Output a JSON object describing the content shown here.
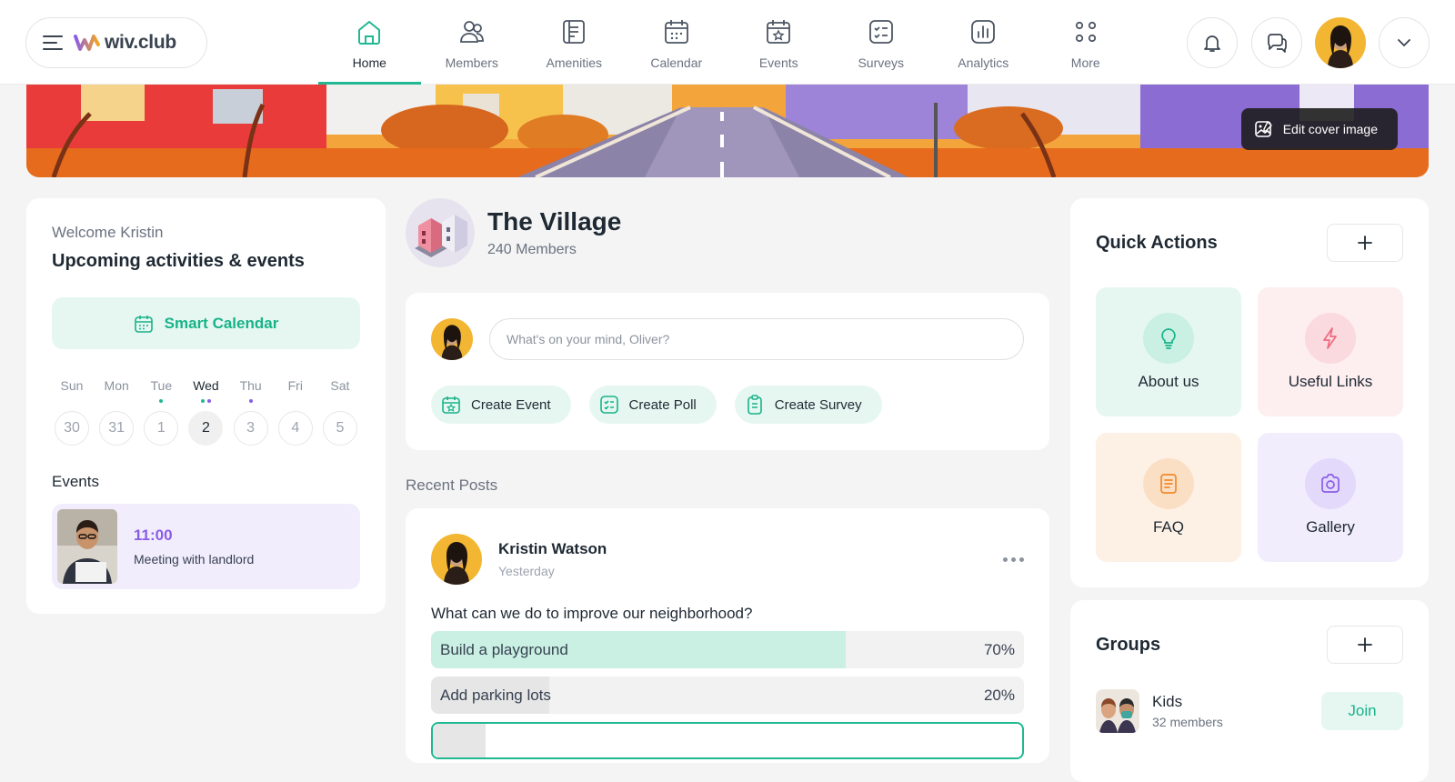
{
  "brand": {
    "name": "wiv.club"
  },
  "nav": [
    {
      "label": "Home",
      "icon": "home-icon",
      "active": true
    },
    {
      "label": "Members",
      "icon": "members-icon"
    },
    {
      "label": "Amenities",
      "icon": "amenities-icon"
    },
    {
      "label": "Calendar",
      "icon": "calendar-icon"
    },
    {
      "label": "Events",
      "icon": "events-icon"
    },
    {
      "label": "Surveys",
      "icon": "surveys-icon"
    },
    {
      "label": "Analytics",
      "icon": "analytics-icon"
    },
    {
      "label": "More",
      "icon": "more-icon"
    }
  ],
  "cover": {
    "edit_label": "Edit cover image"
  },
  "sidebar": {
    "welcome": "Welcome Kristin",
    "title": "Upcoming activities & events",
    "smart_calendar": "Smart Calendar",
    "week": [
      {
        "name": "Sun",
        "num": "30"
      },
      {
        "name": "Mon",
        "num": "31"
      },
      {
        "name": "Tue",
        "num": "1"
      },
      {
        "name": "Wed",
        "num": "2"
      },
      {
        "name": "Thu",
        "num": "3"
      },
      {
        "name": "Fri",
        "num": "4"
      },
      {
        "name": "Sat",
        "num": "5"
      }
    ],
    "events_title": "Events",
    "event": {
      "time": "11:00",
      "desc": "Meeting with landlord"
    }
  },
  "community": {
    "name": "The Village",
    "members": "240 Members"
  },
  "composer": {
    "placeholder": "What's on your mind, Oliver?",
    "actions": [
      "Create Event",
      "Create Poll",
      "Create Survey"
    ]
  },
  "recent_posts_title": "Recent Posts",
  "post": {
    "author": "Kristin Watson",
    "time": "Yesterday",
    "question": "What can we do to improve our neighborhood?",
    "options": [
      {
        "label": "Build a playground",
        "pct": "70%",
        "value": 70
      },
      {
        "label": "Add parking lots",
        "pct": "20%",
        "value": 20
      },
      {
        "label": "",
        "pct": "",
        "value": 9
      }
    ]
  },
  "quick_actions": {
    "title": "Quick Actions",
    "items": [
      {
        "label": "About us",
        "icon": "lightbulb-icon"
      },
      {
        "label": "Useful Links",
        "icon": "lightning-icon"
      },
      {
        "label": "FAQ",
        "icon": "document-icon"
      },
      {
        "label": "Gallery",
        "icon": "camera-icon"
      }
    ]
  },
  "groups": {
    "title": "Groups",
    "items": [
      {
        "name": "Kids",
        "members": "32 members",
        "action": "Join"
      }
    ]
  },
  "colors": {
    "accent": "#21b892",
    "purple": "#8b5ce6"
  }
}
